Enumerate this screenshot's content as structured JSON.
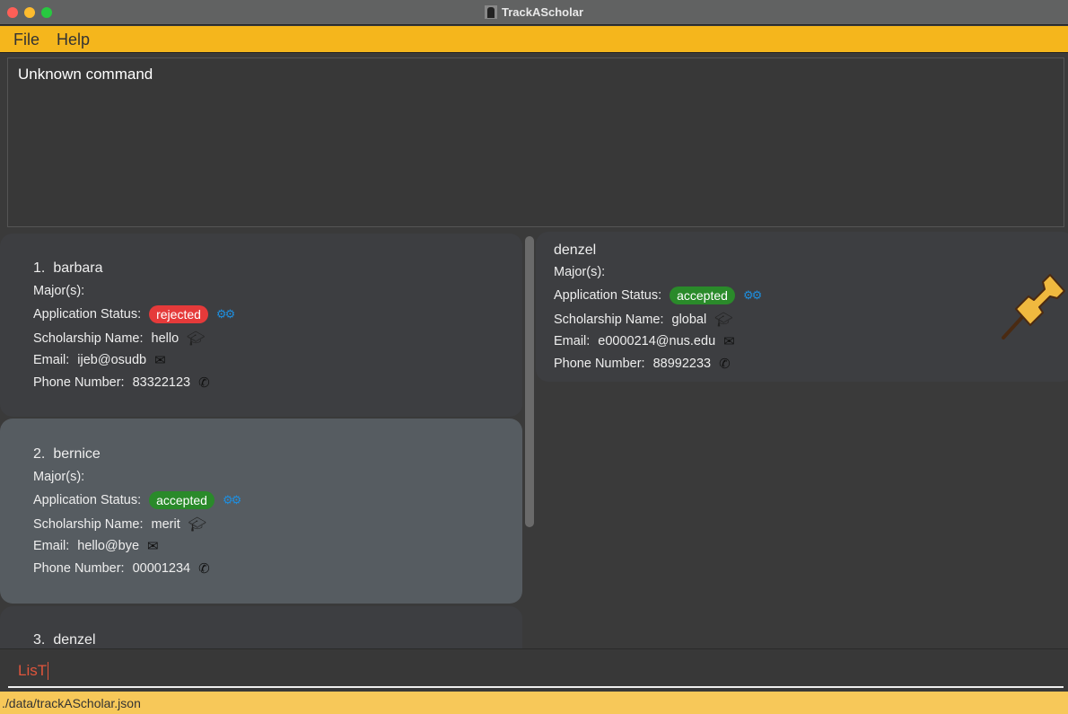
{
  "window": {
    "title": "TrackAScholar"
  },
  "menu": {
    "file": "File",
    "help": "Help"
  },
  "result_display": "Unknown command",
  "labels": {
    "major": "Major(s):",
    "status": "Application Status:",
    "scholarship": "Scholarship Name:",
    "email": "Email:",
    "phone": "Phone Number:"
  },
  "list": [
    {
      "index": "1.",
      "name": "barbara",
      "status": "rejected",
      "scholarship": "hello",
      "email": "ijeb@osudb",
      "phone": "83322123"
    },
    {
      "index": "2.",
      "name": "bernice",
      "status": "accepted",
      "scholarship": "merit",
      "email": "hello@bye",
      "phone": "00001234"
    },
    {
      "index": "3.",
      "name": "denzel"
    }
  ],
  "pinned": {
    "name": "denzel",
    "status": "accepted",
    "scholarship": "global",
    "email": "e0000214@nus.edu",
    "phone": "88992233"
  },
  "command_input": "LisT",
  "status_bar": "./data/trackAScholar.json",
  "colors": {
    "menubar": "#f5b61c",
    "status_bar": "#f7c859",
    "rejected": "#e53a3a",
    "accepted": "#2a8a2a",
    "command_text": "#e0553c",
    "selected_card": "#565c61"
  }
}
